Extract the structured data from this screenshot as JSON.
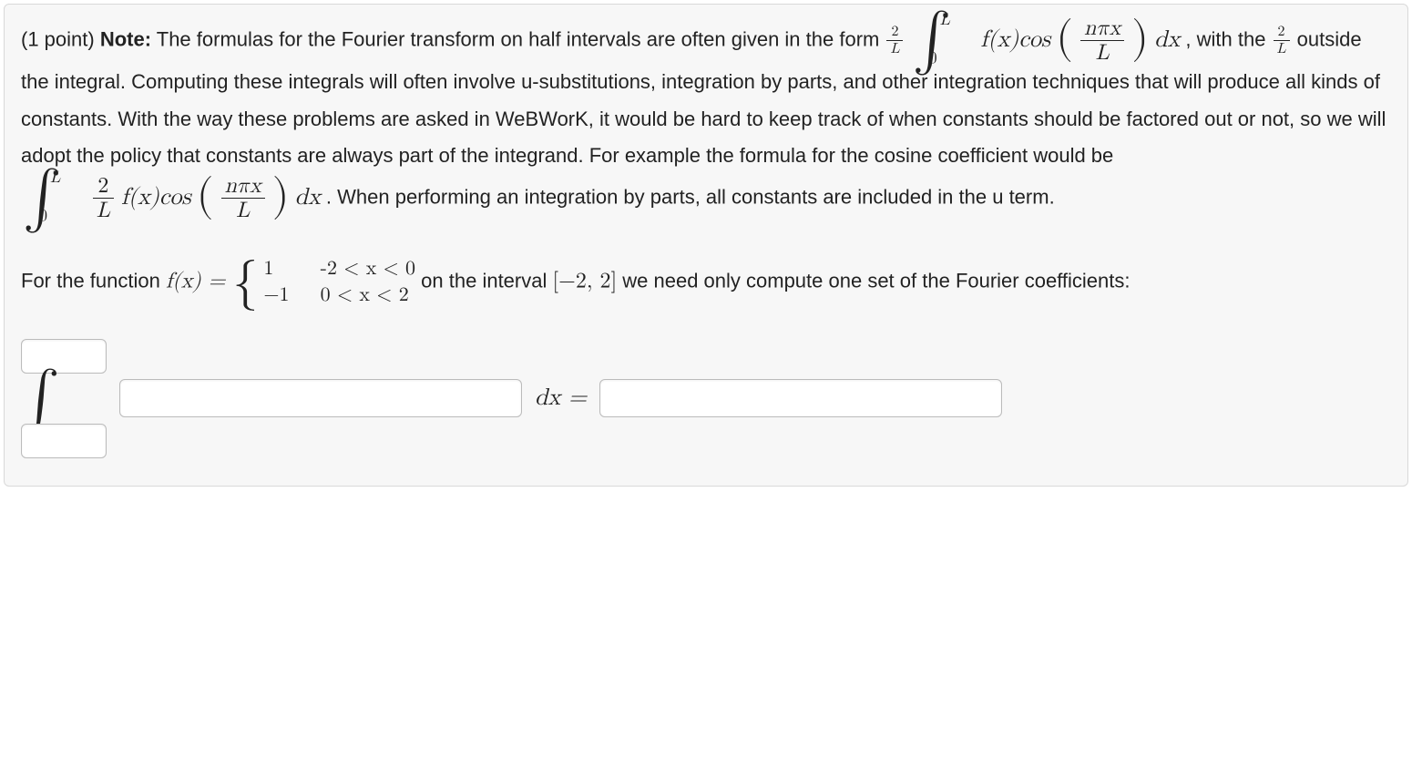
{
  "points_prefix": "(1 point) ",
  "note_label": "Note:",
  "note_body_1": " The formulas for the Fourier transform on half intervals are often given in the form ",
  "formula1": {
    "frac_num": "2",
    "frac_den": "L",
    "int_upper": "L",
    "int_lower": "0",
    "fx": "f(x)cos",
    "inner_num": "nπx",
    "inner_den": "L",
    "dx": " dx"
  },
  "note_body_2": ", with the ",
  "frac2": {
    "num": "2",
    "den": "L"
  },
  "note_body_3": " outside the integral. Computing these integrals will often involve u-substitutions, integration by parts, and other integration techniques that will produce all kinds of constants. With the way these problems are asked in WeBWorK, it would be hard to keep track of when constants should be factored out or not, so we will adopt the policy that constants are always part of the integrand. For example the formula for the cosine coefficient would be ",
  "formula2": {
    "int_upper": "L",
    "int_lower": "0",
    "frac_num": "2",
    "frac_den": "L",
    "fx": "f(x)cos",
    "inner_num": "nπx",
    "inner_den": "L",
    "dx": " dx"
  },
  "note_body_4": ". When performing an integration by parts, all constants are included in the u term.",
  "question": {
    "lead": "For the function ",
    "fx_eq": "f(x) = ",
    "case1_val": "1",
    "case1_cond": "-2 < x < 0",
    "case2_val": "−1",
    "case2_cond": "0 < x < 2",
    "tail_1": " on the interval ",
    "interval": "[−2, 2]",
    "tail_2": " we need only compute one set of the Fourier coefficients:"
  },
  "answer": {
    "dx_eq": " dx ="
  }
}
